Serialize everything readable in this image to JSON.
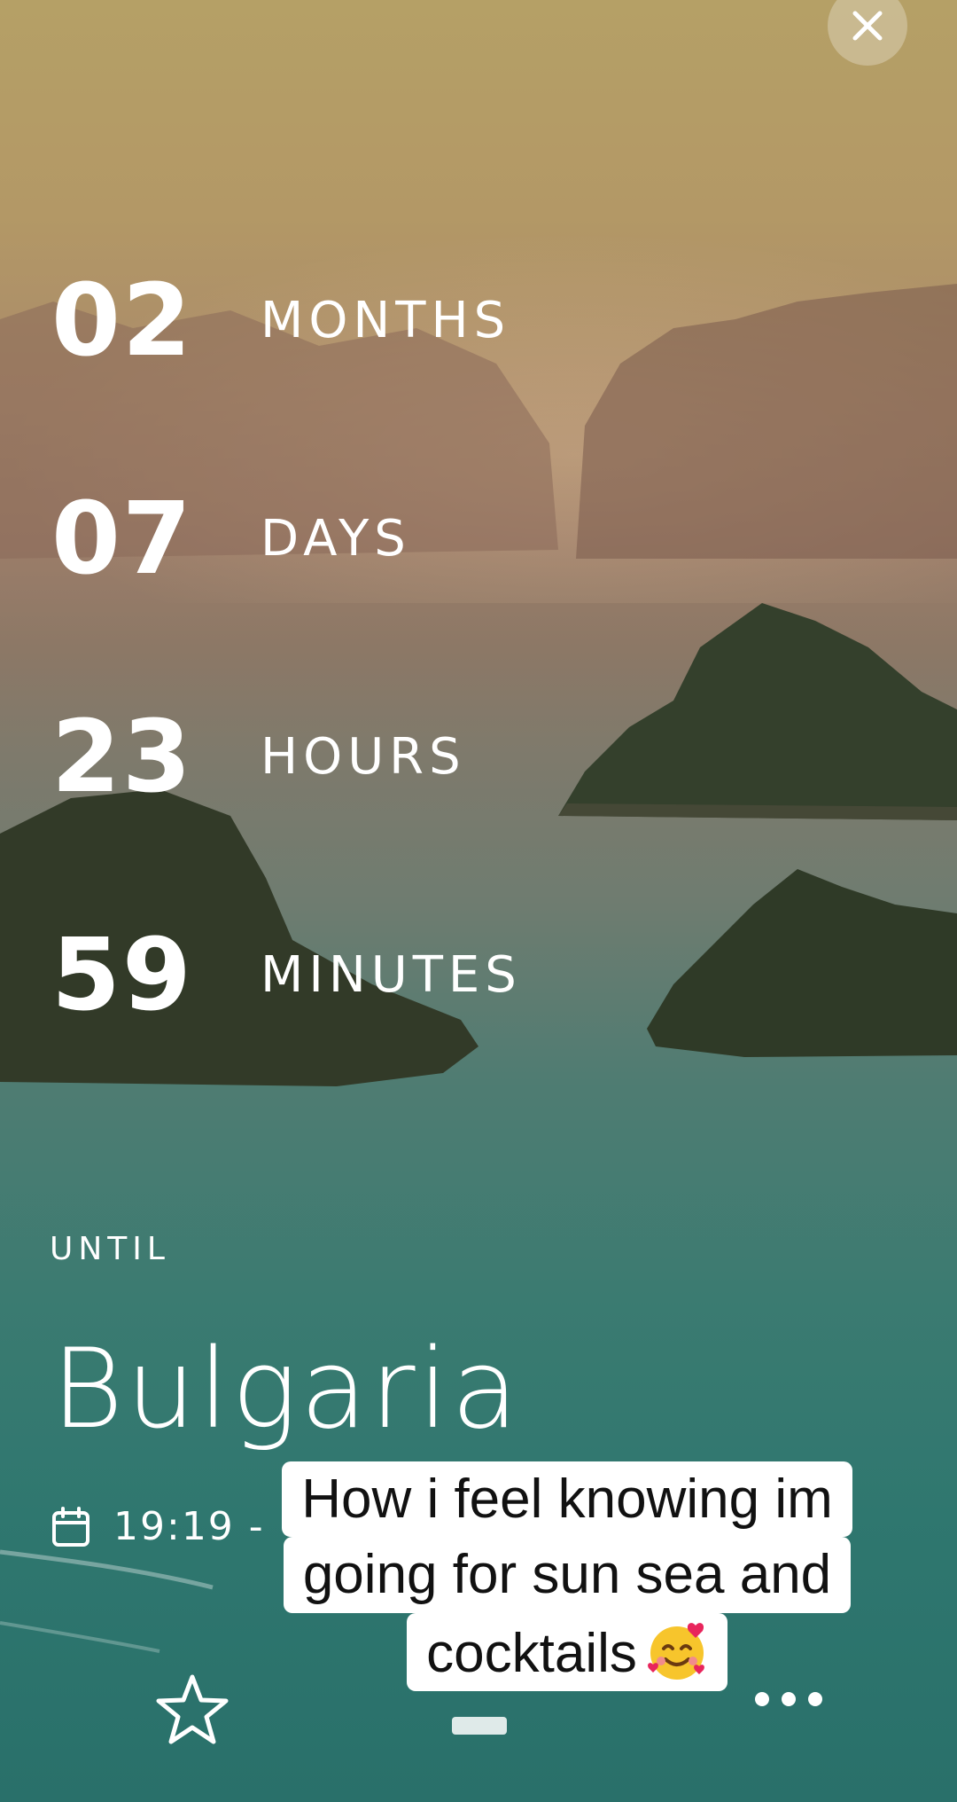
{
  "countdown": [
    {
      "value": "02",
      "unit": "MONTHS"
    },
    {
      "value": "07",
      "unit": "DAYS"
    },
    {
      "value": "23",
      "unit": "HOURS"
    },
    {
      "value": "59",
      "unit": "MINUTES"
    }
  ],
  "until_label": "UNTIL",
  "destination": "Bulgaria",
  "date_text": "19:19 -",
  "caption": {
    "lines": [
      "How i feel knowing im",
      "going for sun sea and",
      "cocktails"
    ],
    "emoji": "smiling-face-with-hearts"
  },
  "icons": {
    "close": "close-icon",
    "calendar": "calendar-icon",
    "favorite": "star-icon",
    "more": "more-icon"
  }
}
